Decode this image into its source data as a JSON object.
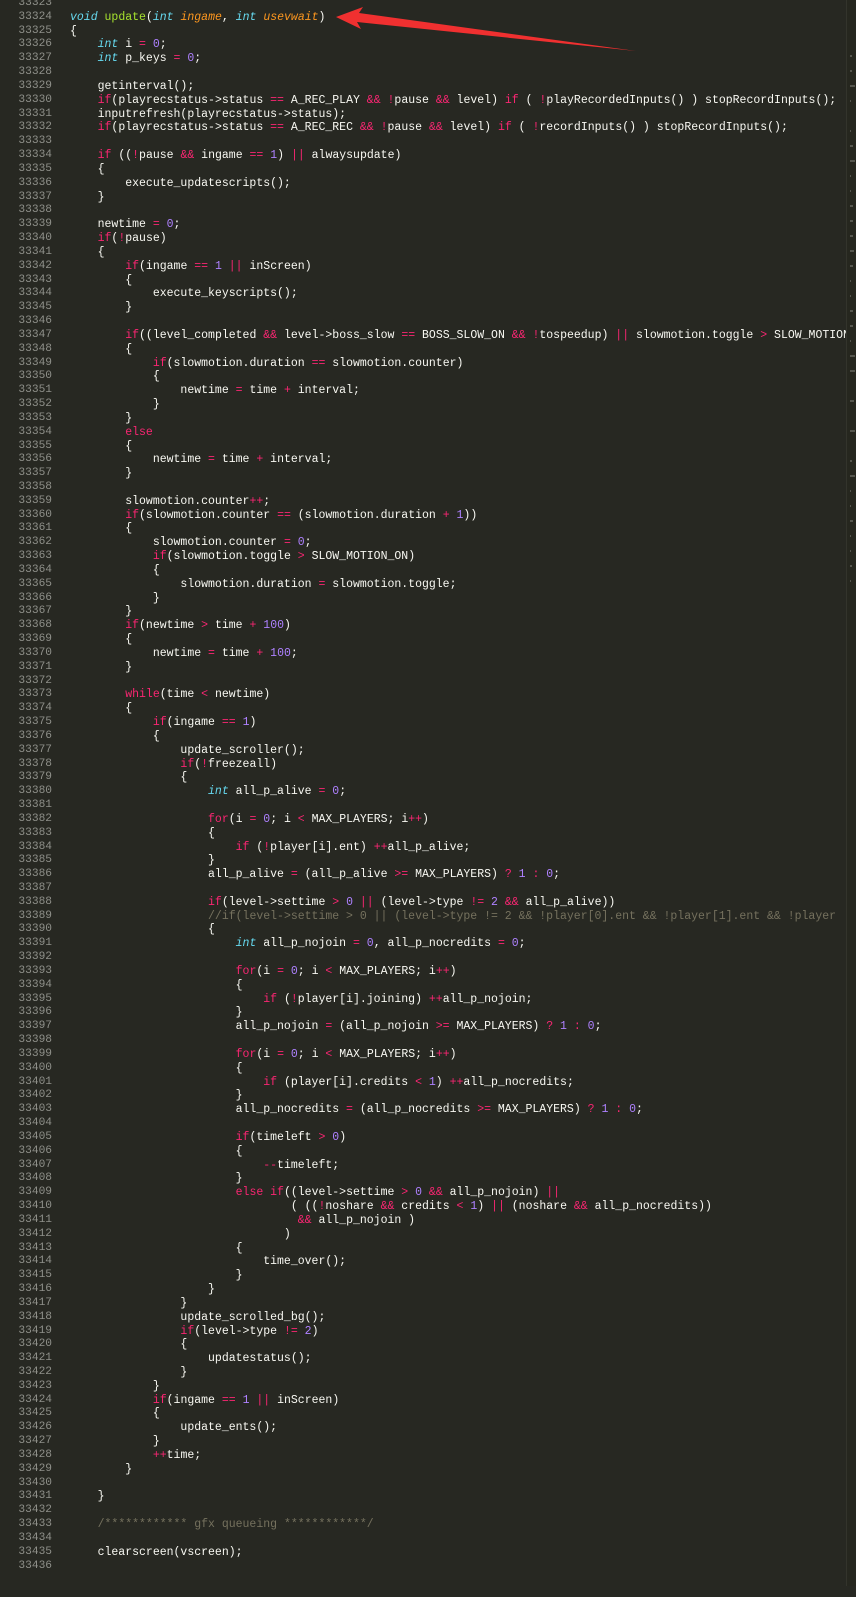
{
  "editor": {
    "first_line_number": 33323,
    "colors": {
      "background": "#272822",
      "keyword": "#f92672",
      "type": "#66d9ef",
      "number": "#ae81ff",
      "comment": "#75715e",
      "function": "#a6e22e",
      "parameter": "#fd971f",
      "text": "#f8f8f2",
      "annotation_arrow": "#f03030"
    },
    "lines": [
      "",
      "void update(int ingame, int usevwait)",
      "{",
      "    int i = 0;",
      "    int p_keys = 0;",
      "",
      "    getinterval();",
      "    if(playrecstatus->status == A_REC_PLAY && !pause && level) if ( !playRecordedInputs() ) stopRecordInputs();",
      "    inputrefresh(playrecstatus->status);",
      "    if(playrecstatus->status == A_REC_REC && !pause && level) if ( !recordInputs() ) stopRecordInputs();",
      "",
      "    if ((!pause && ingame == 1) || alwaysupdate)",
      "    {",
      "        execute_updatescripts();",
      "    }",
      "",
      "    newtime = 0;",
      "    if(!pause)",
      "    {",
      "        if(ingame == 1 || inScreen)",
      "        {",
      "            execute_keyscripts();",
      "        }",
      "",
      "        if((level_completed && level->boss_slow == BOSS_SLOW_ON && !tospeedup) || slowmotion.toggle > SLOW_MOTION_ON)",
      "        {",
      "            if(slowmotion.duration == slowmotion.counter)",
      "            {",
      "                newtime = time + interval;",
      "            }",
      "        }",
      "        else",
      "        {",
      "            newtime = time + interval;",
      "        }",
      "",
      "        slowmotion.counter++;",
      "        if(slowmotion.counter == (slowmotion.duration + 1))",
      "        {",
      "            slowmotion.counter = 0;",
      "            if(slowmotion.toggle > SLOW_MOTION_ON)",
      "            {",
      "                slowmotion.duration = slowmotion.toggle;",
      "            }",
      "        }",
      "        if(newtime > time + 100)",
      "        {",
      "            newtime = time + 100;",
      "        }",
      "",
      "        while(time < newtime)",
      "        {",
      "            if(ingame == 1)",
      "            {",
      "                update_scroller();",
      "                if(!freezeall)",
      "                {",
      "                    int all_p_alive = 0;",
      "",
      "                    for(i = 0; i < MAX_PLAYERS; i++)",
      "                    {",
      "                        if (!player[i].ent) ++all_p_alive;",
      "                    }",
      "                    all_p_alive = (all_p_alive >= MAX_PLAYERS) ? 1 : 0;",
      "",
      "                    if(level->settime > 0 || (level->type != 2 && all_p_alive))",
      "                    //if(level->settime > 0 || (level->type != 2 && !player[0].ent && !player[1].ent && !player",
      "                    {",
      "                        int all_p_nojoin = 0, all_p_nocredits = 0;",
      "",
      "                        for(i = 0; i < MAX_PLAYERS; i++)",
      "                        {",
      "                            if (!player[i].joining) ++all_p_nojoin;",
      "                        }",
      "                        all_p_nojoin = (all_p_nojoin >= MAX_PLAYERS) ? 1 : 0;",
      "",
      "                        for(i = 0; i < MAX_PLAYERS; i++)",
      "                        {",
      "                            if (player[i].credits < 1) ++all_p_nocredits;",
      "                        }",
      "                        all_p_nocredits = (all_p_nocredits >= MAX_PLAYERS) ? 1 : 0;",
      "",
      "                        if(timeleft > 0)",
      "                        {",
      "                            --timeleft;",
      "                        }",
      "                        else if((level->settime > 0 && all_p_nojoin) ||",
      "                                ( ((!noshare && credits < 1) || (noshare && all_p_nocredits))",
      "                                 && all_p_nojoin )",
      "                               )",
      "                        {",
      "                            time_over();",
      "                        }",
      "                    }",
      "                }",
      "                update_scrolled_bg();",
      "                if(level->type != 2)",
      "                {",
      "                    updatestatus();",
      "                }",
      "            }",
      "            if(ingame == 1 || inScreen)",
      "            {",
      "                update_ents();",
      "            }",
      "            ++time;",
      "        }",
      "",
      "    }",
      "",
      "    /************ gfx queueing ************/",
      "",
      "    clearscreen(vscreen);",
      ""
    ]
  }
}
